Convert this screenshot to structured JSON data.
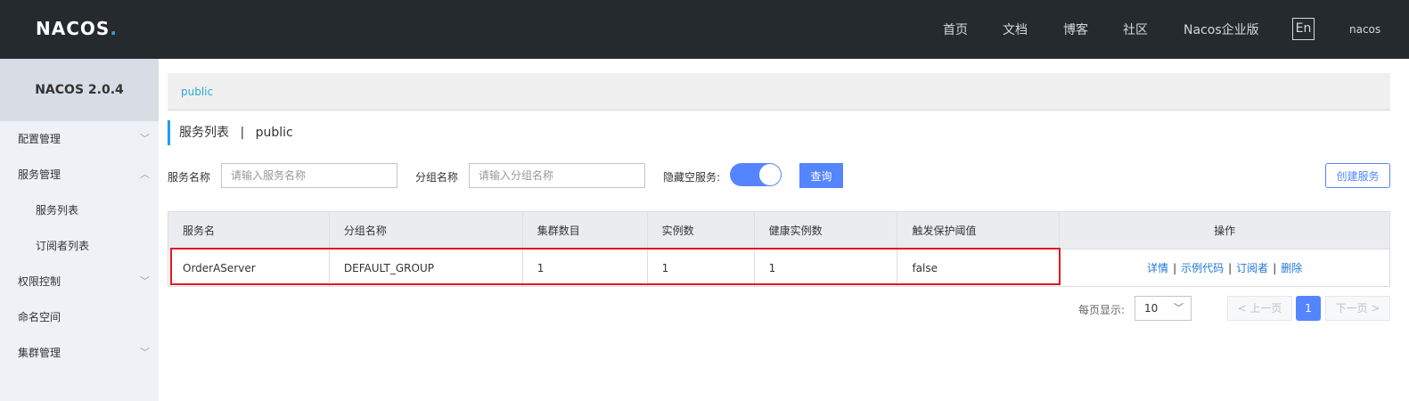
{
  "header": {
    "logo_text": "NACOS",
    "logo_dot": ".",
    "nav": [
      "首页",
      "文档",
      "博客",
      "社区",
      "Nacos企业版"
    ],
    "lang_button": "En",
    "user": "nacos"
  },
  "sidebar": {
    "title": "NACOS 2.0.4",
    "items": [
      {
        "label": "配置管理",
        "chevron": "﹀"
      },
      {
        "label": "服务管理",
        "chevron": "︿"
      },
      {
        "label": "服务列表",
        "chevron": ""
      },
      {
        "label": "订阅者列表",
        "chevron": ""
      },
      {
        "label": "权限控制",
        "chevron": "﹀"
      },
      {
        "label": "命名空间",
        "chevron": ""
      },
      {
        "label": "集群管理",
        "chevron": "﹀"
      }
    ]
  },
  "breadcrumb": {
    "namespace": "public"
  },
  "page": {
    "title": "服务列表",
    "separator": "|",
    "namespace": "public"
  },
  "filters": {
    "service_name_label": "服务名称",
    "service_name_placeholder": "请输入服务名称",
    "group_name_label": "分组名称",
    "group_name_placeholder": "请输入分组名称",
    "hide_empty_label": "隐藏空服务:",
    "hide_empty_on": true,
    "query_button": "查询",
    "create_button": "创建服务"
  },
  "table": {
    "headers": [
      "服务名",
      "分组名称",
      "集群数目",
      "实例数",
      "健康实例数",
      "触发保护阈值",
      "操作"
    ],
    "rows": [
      {
        "service": "OrderAServer",
        "group": "DEFAULT_GROUP",
        "clusters": "1",
        "instances": "1",
        "healthy": "1",
        "threshold": "false",
        "ops": [
          "详情",
          "示例代码",
          "订阅者",
          "删除"
        ]
      }
    ]
  },
  "pagination": {
    "page_size_label": "每页显示:",
    "page_size": "10",
    "prev": "< 上一页",
    "current": "1",
    "next": "下一页 >"
  },
  "colors": {
    "topbar": "#252a2f",
    "accent": "#5584ff",
    "highlight": "#e0191f"
  }
}
